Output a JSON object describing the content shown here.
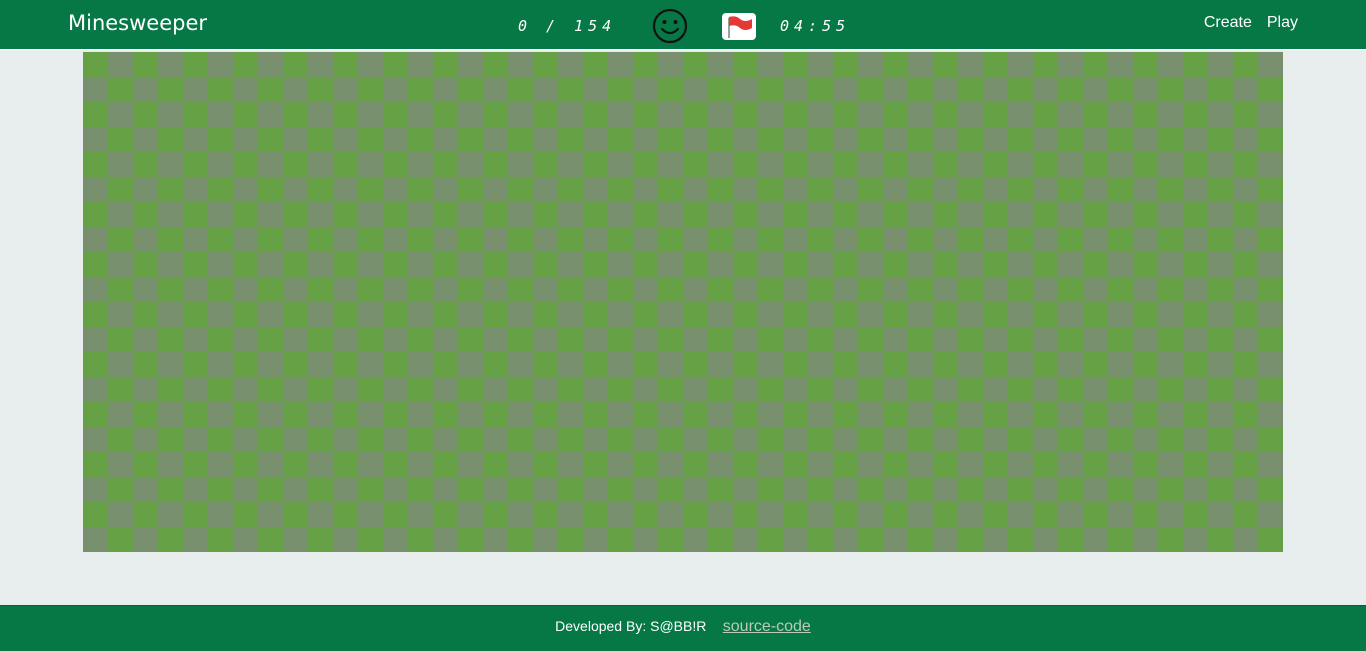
{
  "header": {
    "title": "Minesweeper",
    "flag_counter": "0 / 154",
    "timer": "04:55",
    "nav": [
      {
        "label": "Create"
      },
      {
        "label": "Play"
      }
    ]
  },
  "board": {
    "rows": 20,
    "cols": 48,
    "state": "all-cells-unrevealed",
    "cell_colors": [
      "#66a044",
      "#778f6d"
    ]
  },
  "footer": {
    "credit": "Developed By: S@BB!R",
    "link_label": "source-code"
  },
  "colors": {
    "primary": "#057845",
    "background": "#e8eded",
    "flag_red": "#e53935"
  },
  "icons": {
    "status_face": "smiley-face-icon",
    "flag_mode": "red-flag-icon"
  }
}
